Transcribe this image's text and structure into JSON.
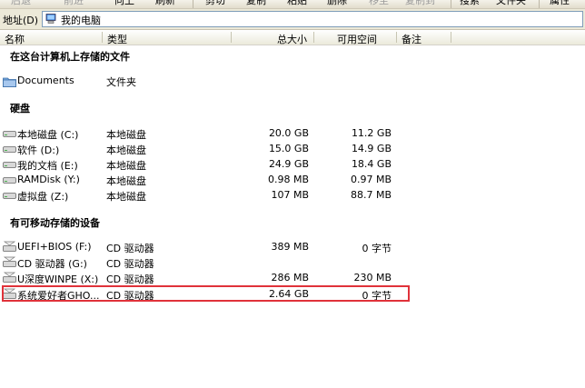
{
  "toolbar": {
    "buttons": [
      "后退",
      "前进",
      "向上",
      "刷新",
      "剪切",
      "复制",
      "粘贴",
      "删除",
      "移至",
      "复制到",
      "搜索",
      "文件夹",
      "属性"
    ]
  },
  "address": {
    "label": "地址(D)",
    "value": "我的电脑"
  },
  "columns": {
    "name": "名称",
    "type": "类型",
    "total": "总大小",
    "free": "可用空间",
    "note": "备注"
  },
  "sections": {
    "stored": {
      "title": "在这台计算机上存储的文件",
      "items": [
        {
          "name": "Documents",
          "type": "文件夹",
          "total": "",
          "free": ""
        }
      ]
    },
    "hdd": {
      "title": "硬盘",
      "items": [
        {
          "name": "本地磁盘 (C:)",
          "type": "本地磁盘",
          "total": "20.0 GB",
          "free": "11.2 GB"
        },
        {
          "name": "软件 (D:)",
          "type": "本地磁盘",
          "total": "15.0 GB",
          "free": "14.9 GB"
        },
        {
          "name": "我的文档 (E:)",
          "type": "本地磁盘",
          "total": "24.9 GB",
          "free": "18.4 GB"
        },
        {
          "name": "RAMDisk (Y:)",
          "type": "本地磁盘",
          "total": "0.98 MB",
          "free": "0.97 MB"
        },
        {
          "name": "虚拟盘 (Z:)",
          "type": "本地磁盘",
          "total": "107 MB",
          "free": "88.7 MB"
        }
      ]
    },
    "removable": {
      "title": "有可移动存储的设备",
      "items": [
        {
          "name": "UEFI+BIOS (F:)",
          "type": "CD 驱动器",
          "total": "389 MB",
          "free": "0 字节"
        },
        {
          "name": "CD 驱动器 (G:)",
          "type": "CD 驱动器",
          "total": "",
          "free": ""
        },
        {
          "name": "U深度WINPE (X:)",
          "type": "CD 驱动器",
          "total": "286 MB",
          "free": "230 MB"
        },
        {
          "name": "系统爱好者GHO...",
          "type": "CD 驱动器",
          "total": "2.64 GB",
          "free": "0 字节"
        }
      ]
    }
  },
  "colors": {
    "highlight": "#e0323a"
  }
}
